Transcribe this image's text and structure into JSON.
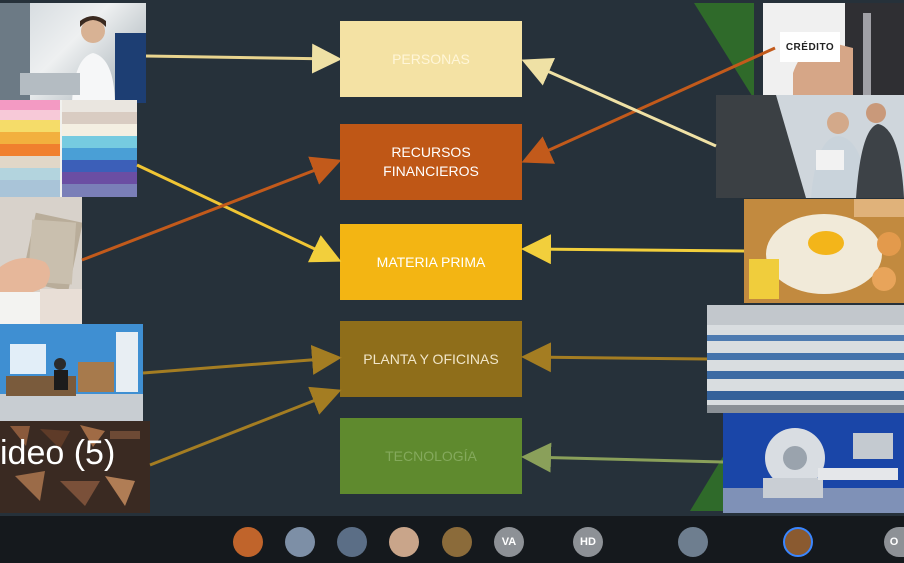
{
  "slide": {
    "boxes": {
      "personas": "PERSONAS",
      "recursos_line1": "RECURSOS",
      "recursos_line2": "FINANCIEROS",
      "materia": "MATERIA PRIMA",
      "planta": "PLANTA Y OFICINAS",
      "tecnologia": "TECNOLOGÍA"
    },
    "credito_card": "CRÉDITO",
    "video_label": "ideo (5)"
  },
  "participants": {
    "initials": [
      "VA",
      "HD",
      "O"
    ]
  },
  "colors": {
    "personas": "#f4e2a4",
    "recursos": "#bf5716",
    "materia": "#f3b513",
    "planta": "#8f6e1a",
    "tecnologia": "#5f8a2e",
    "background": "#26313a"
  },
  "icons": [
    "photo-seamstress",
    "photo-fabric",
    "photo-money",
    "photo-office",
    "photo-leather",
    "photo-credit",
    "photo-car-dealer",
    "photo-flour-eggs",
    "photo-factory",
    "photo-medical-machine",
    "participant-avatar"
  ]
}
